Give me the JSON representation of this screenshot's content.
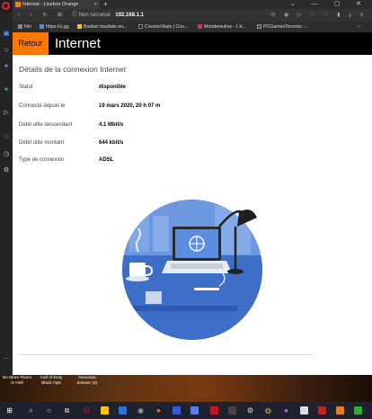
{
  "browser": {
    "tab_title": "Internet - Livebox Orange",
    "tab_close": "×",
    "new_tab": "+",
    "security_label": "Non sécurisé",
    "url": "192.168.1.1",
    "bookmarks": [
      {
        "label": "film",
        "color": "#888888"
      },
      {
        "label": "https://u.gg",
        "color": "#5b8dd6"
      },
      {
        "label": "Basket résultats en...",
        "color": "#f5c518"
      },
      {
        "label": "CounterStats | Cou...",
        "color": "#222222"
      },
      {
        "label": "Mondemulme - L'é...",
        "color": "#cc3366"
      },
      {
        "label": "PCGamesTorrents -...",
        "color": "#444444"
      }
    ]
  },
  "page": {
    "back_label": "Retour",
    "title": "Internet",
    "section_title": "Détails de la connexion Internet",
    "rows": [
      {
        "label": "Statut",
        "value": "disponible"
      },
      {
        "label": "Connecté depuis le",
        "value": "19 mars 2020, 20 h 07 m"
      },
      {
        "label": "Débit utile descendant",
        "value": "4.1 Mbit/s"
      },
      {
        "label": "Débit utile montant",
        "value": "644 kbit/s"
      },
      {
        "label": "Type de connexion",
        "value": "ADSL"
      }
    ]
  },
  "desktop": {
    "icons": [
      {
        "label": "No More Room in Hell"
      },
      {
        "label": "Call of Duty Black Ops"
      },
      {
        "label": "Nouveau dossier (4)"
      }
    ]
  },
  "colors": {
    "orange": "#ff7900",
    "header_bg": "#000000",
    "illustration_blue": "#4a7fd6"
  }
}
